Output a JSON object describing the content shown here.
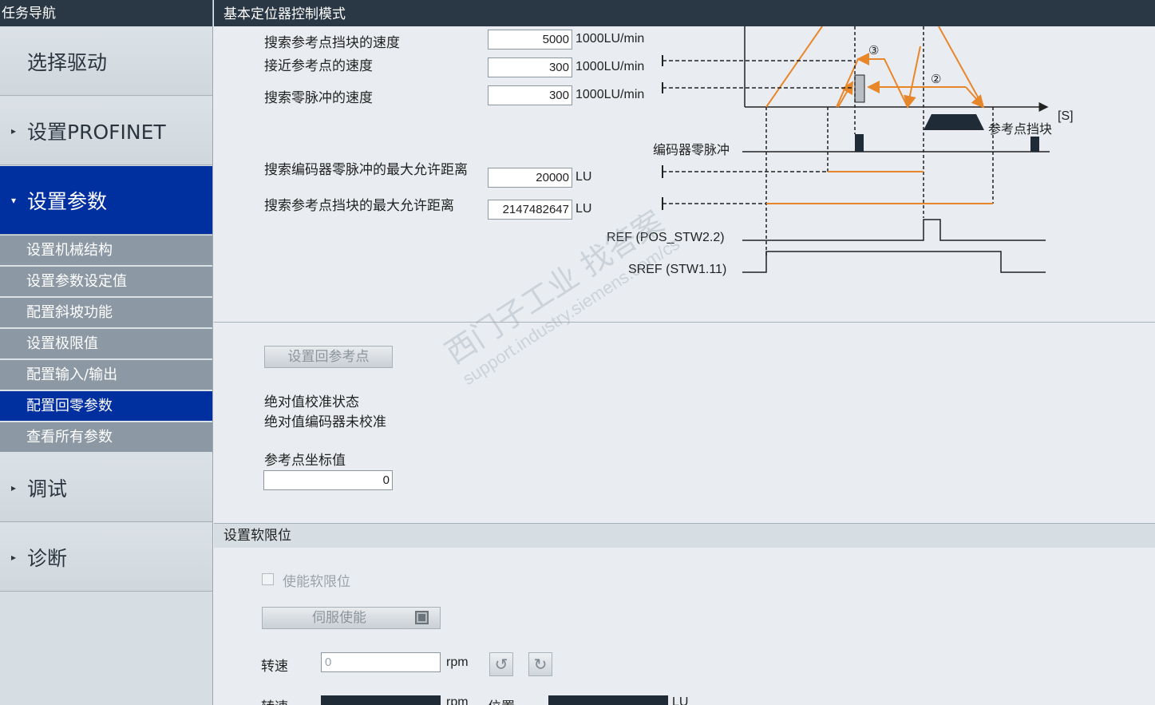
{
  "sidebar": {
    "title": "任务导航",
    "sections": [
      {
        "label": "选择驱动",
        "arrow": ""
      },
      {
        "label": "设置PROFINET",
        "arrow": "▸"
      },
      {
        "label": "设置参数",
        "arrow": "▾"
      },
      {
        "label": "调试",
        "arrow": "▸"
      },
      {
        "label": "诊断",
        "arrow": "▸"
      }
    ],
    "sub_items": [
      {
        "label": "设置机械结构"
      },
      {
        "label": "设置参数设定值"
      },
      {
        "label": "配置斜坡功能"
      },
      {
        "label": "设置极限值"
      },
      {
        "label": "配置输入/输出"
      },
      {
        "label": "配置回零参数"
      },
      {
        "label": "查看所有参数"
      }
    ]
  },
  "main": {
    "title": "基本定位器控制模式",
    "speed_params": [
      {
        "label": "搜索参考点挡块的速度",
        "value": "5000",
        "unit": "1000LU/min"
      },
      {
        "label": "接近参考点的速度",
        "value": "300",
        "unit": "1000LU/min"
      },
      {
        "label": "搜索零脉冲的速度",
        "value": "300",
        "unit": "1000LU/min"
      }
    ],
    "distance_params": [
      {
        "label": "搜索编码器零脉冲的最大允许距离",
        "value": "20000",
        "unit": "LU"
      },
      {
        "label": "搜索参考点挡块的最大允许距离",
        "value": "2147482647",
        "unit": "LU"
      }
    ],
    "diagram": {
      "axis_label": "[S]",
      "cam_label": "参考点挡块",
      "encoder_label": "编码器零脉冲",
      "ref_label": "REF (POS_STW2.2)",
      "sref_label": "SREF (STW1.11)",
      "marker_3": "③",
      "marker_2": "②",
      "accent": "#e8862a"
    },
    "set_ref_button": "设置回参考点",
    "abs_status_label": "绝对值校准状态",
    "abs_status_value": "绝对值编码器未校准",
    "ref_coord_label": "参考点坐标值",
    "ref_coord_value": "0",
    "soft_limit": {
      "title": "设置软限位",
      "enable_label": "使能软限位",
      "servo_button": "伺服使能",
      "speed_label": "转速",
      "speed_value": "0",
      "speed_unit": "rpm",
      "actual_speed_label": "转速",
      "actual_speed_unit": "rpm",
      "position_label": "位置",
      "position_unit": "LU"
    },
    "watermark": {
      "line1": "西门子工业  找答案",
      "line2": "support.industry.siemens.com/cs"
    }
  }
}
